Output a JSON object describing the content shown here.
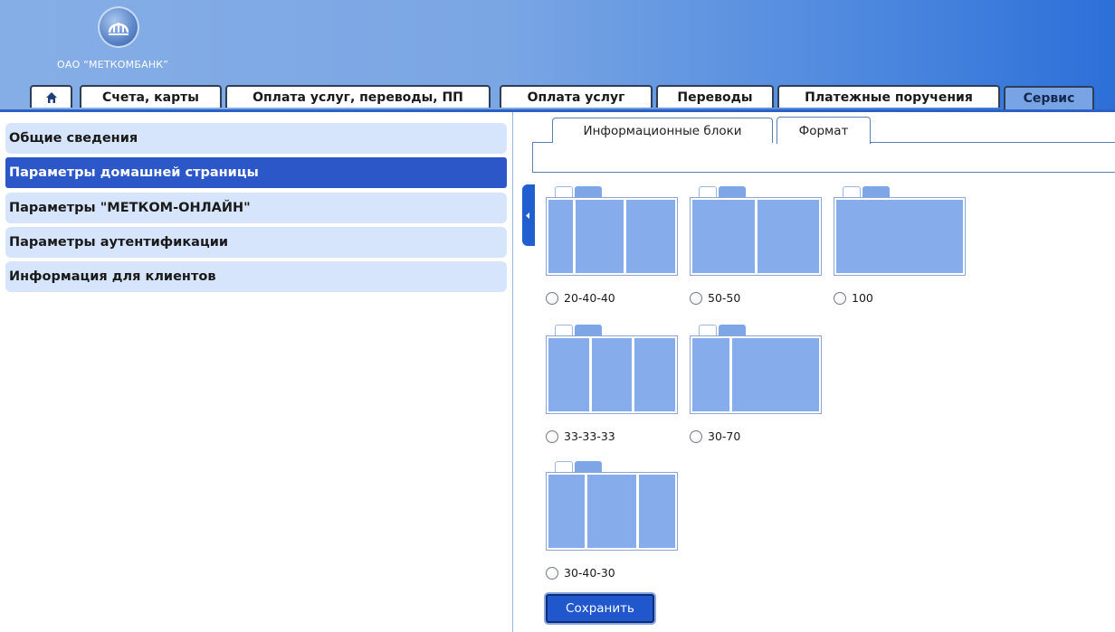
{
  "header": {
    "bank_name": "ОАО “МЕТКОМБАНК”"
  },
  "top_tabs": [
    {
      "label": "Счета, карты"
    },
    {
      "label": "Оплата услуг, переводы, ПП"
    },
    {
      "label": "Оплата услуг"
    },
    {
      "label": "Переводы"
    },
    {
      "label": "Платежные поручения"
    },
    {
      "label": "Сервис",
      "active": true
    }
  ],
  "sidebar": {
    "items": [
      {
        "label": "Общие сведения"
      },
      {
        "label": "Параметры домашней страницы",
        "active": true
      },
      {
        "label": "Параметры \"МЕТКОМ-ОНЛАЙН\""
      },
      {
        "label": "Параметры аутентификации"
      },
      {
        "label": "Информация для клиентов"
      }
    ]
  },
  "subtabs": [
    {
      "label": "Информационные блоки"
    },
    {
      "label": "Формат",
      "active": true
    }
  ],
  "layouts": [
    {
      "label": "20-40-40",
      "columns": [
        20,
        40,
        40
      ],
      "selected": false
    },
    {
      "label": "50-50",
      "columns": [
        50,
        50
      ],
      "selected": false
    },
    {
      "label": "100",
      "columns": [
        100
      ],
      "selected": false
    },
    {
      "label": "33-33-33",
      "columns": [
        33,
        33,
        33
      ],
      "selected": false
    },
    {
      "label": "30-70",
      "columns": [
        30,
        70
      ],
      "selected": false
    },
    {
      "label": "30-40-30",
      "columns": [
        30,
        40,
        30
      ],
      "selected": false
    }
  ],
  "actions": {
    "save_label": "Сохранить"
  },
  "colors": {
    "accent": "#2c57c9",
    "tab_active": "#78a3e4",
    "sidebar_item_bg": "#d6e5fb",
    "layout_column": "#86aceb"
  }
}
